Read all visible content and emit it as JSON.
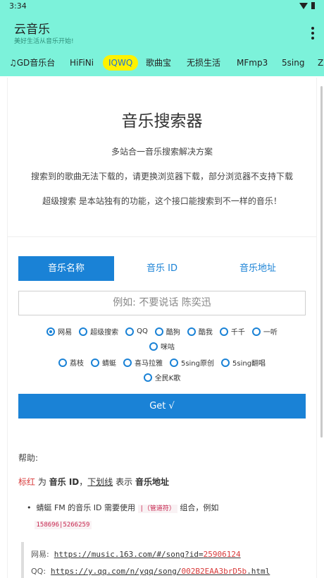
{
  "status": {
    "time": "3:34"
  },
  "app": {
    "title": "云音乐",
    "subtitle": "美好生活从音乐开始!"
  },
  "tabs": [
    "♫GD音乐台",
    "HiFiNi",
    "IQWQ",
    "歌曲宝",
    "无损生活",
    "MFmp3",
    "5sing",
    "Z"
  ],
  "active_tab": "IQWQ",
  "main": {
    "title": "音乐搜索器",
    "desc1": "多站合一音乐搜索解决方案",
    "desc2": "搜索到的歌曲无法下载的，请更换浏览器下载，部分浏览器不支持下载",
    "desc3": "超级搜索 是本站独有的功能，这个接口能搜索到不一样的音乐！"
  },
  "modes": [
    "音乐名称",
    "音乐 ID",
    "音乐地址"
  ],
  "search": {
    "placeholder": "例如: 不要说话 陈奕迅"
  },
  "sources": {
    "row1": [
      "网易",
      "超级搜索",
      "QQ",
      "酷狗",
      "酷我",
      "千千",
      "一听"
    ],
    "row2": [
      "咪咕"
    ],
    "row3": [
      "荔枝",
      "蜻蜓",
      "喜马拉雅",
      "5sing原创",
      "5sing翻唱"
    ],
    "row4": [
      "全民K歌"
    ],
    "selected": "网易"
  },
  "submit_label": "Get √",
  "help": {
    "title": "帮助:",
    "red_word": "标红",
    "is_word": " 为 ",
    "id_word": "音乐 ID",
    "comma": "，",
    "underline_word": "下划线",
    "means": " 表示 ",
    "url_word": "音乐地址",
    "bullet_text1": "蜻蜓 FM 的音乐 ID 需要使用 ",
    "bullet_code1": "|（管道符）",
    "bullet_text2": " 组合，例如",
    "bullet_code2": "158696|5266259",
    "ex1_label": "网易:",
    "ex1_prefix": "https://music.163.com/#/song?id=",
    "ex1_id": "25906124",
    "ex2_label": "QQ:",
    "ex2_prefix": "https://y.qq.com/n/yqq/song/",
    "ex2_id": "002B2EAA3brD5b",
    "ex2_suffix": ".html"
  }
}
